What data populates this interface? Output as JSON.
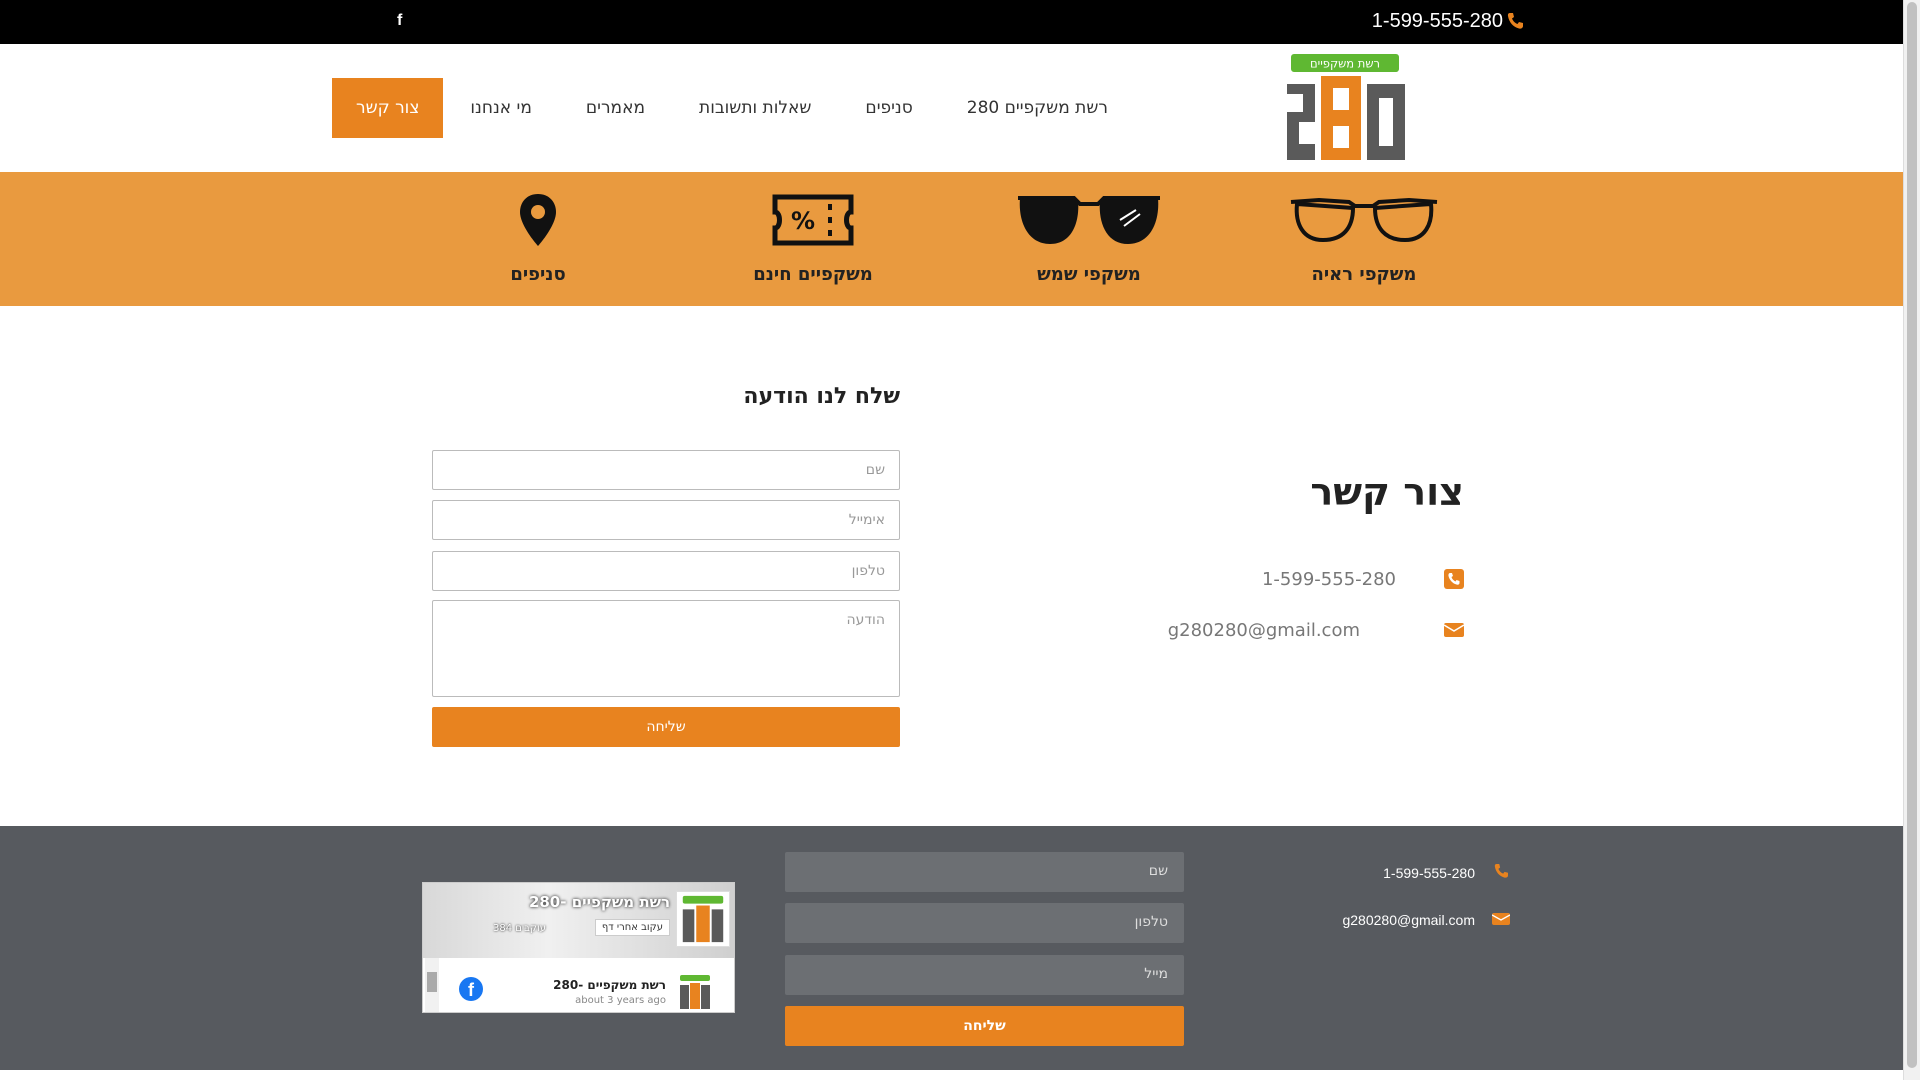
{
  "topbar": {
    "facebook_label": "f",
    "phone": "1-599-555-280"
  },
  "nav": {
    "items": [
      {
        "label": "רשת משקפיים 280"
      },
      {
        "label": "סניפים"
      },
      {
        "label": "שאלות ותשובות"
      },
      {
        "label": "מאמרים"
      },
      {
        "label": "מי אנחנו"
      },
      {
        "label": "צור קשר",
        "active": true
      }
    ]
  },
  "logo": {
    "badge_text": "רשת משקפיים",
    "number": "280"
  },
  "categories": [
    {
      "label": "משקפי ראיה",
      "icon": "eyeglasses-icon"
    },
    {
      "label": "משקפי שמש",
      "icon": "sunglasses-icon"
    },
    {
      "label": "משקפיים חינם",
      "icon": "discount-ticket-icon"
    },
    {
      "label": "סניפים",
      "icon": "map-pin-icon"
    }
  ],
  "form": {
    "title": "שלח לנו הודעה",
    "name_placeholder": "שם",
    "email_placeholder": "אימייל",
    "phone_placeholder": "טלפון",
    "message_placeholder": "הודעה",
    "submit_label": "שליחה"
  },
  "contact": {
    "title": "צור קשר",
    "phone": "1-599-555-280",
    "email": "g280280@gmail.com"
  },
  "footer": {
    "phone": "1-599-555-280",
    "email": "g280280@gmail.com",
    "form": {
      "name_placeholder": "שם",
      "phone_placeholder": "טלפון",
      "email_placeholder": "מייל",
      "submit_label": "שליחה"
    },
    "facebook_widget": {
      "page_name": "280- רשת משקפיים",
      "follow_label": "עקוב אחרי דף",
      "followers": "384 עוקבים",
      "post_name": "280- רשת משקפיים",
      "post_time": "about 3 years ago"
    }
  },
  "colors": {
    "accent": "#e8831f",
    "category_bar": "#e99a3f",
    "footer_bg": "#575a5f",
    "logo_green": "#5fb832",
    "logo_gray": "#5a5a5a"
  }
}
